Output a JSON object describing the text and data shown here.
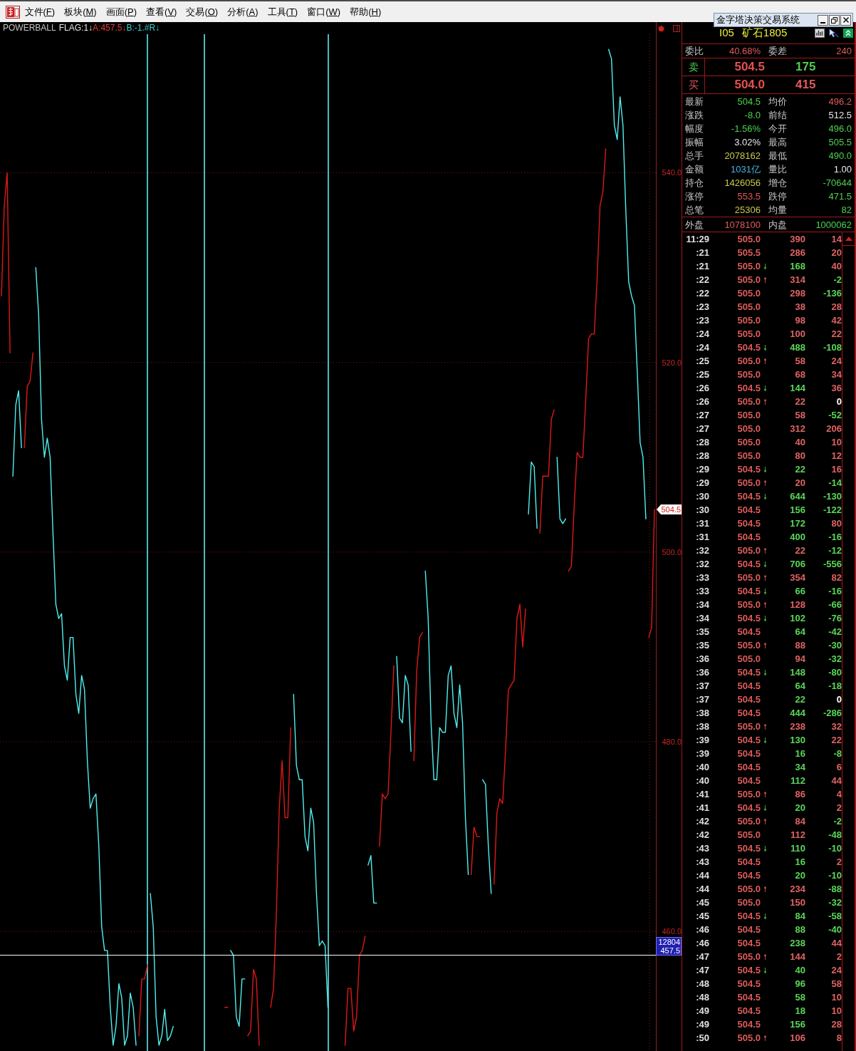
{
  "menu_bar": {
    "items": [
      {
        "before": "文件(",
        "key": "F",
        "after": ")"
      },
      {
        "before": "板块(",
        "key": "M",
        "after": ")"
      },
      {
        "before": "画面(",
        "key": "P",
        "after": ")"
      },
      {
        "before": "查看(",
        "key": "V",
        "after": ")"
      },
      {
        "before": "交易(",
        "key": "O",
        "after": ")"
      },
      {
        "before": "分析(",
        "key": "A",
        "after": ")"
      },
      {
        "before": "工具(",
        "key": "T",
        "after": ")"
      },
      {
        "before": "窗口(",
        "key": "W",
        "after": ")"
      },
      {
        "before": "帮助(",
        "key": "H",
        "after": ")"
      }
    ]
  },
  "floating_window": {
    "title": "金字塔决策交易系统"
  },
  "chart": {
    "legend": [
      {
        "text": "FLAG:1↓",
        "color": "#e4e4e4"
      },
      {
        "text": "A:457.5↓",
        "color": "#e03c3c"
      },
      {
        "text": "B:-1.#R↓",
        "color": "#3cd0d0"
      }
    ],
    "crosshair_label": "12804",
    "chart_data": {
      "type": "line",
      "title": "POWERBALL",
      "grid": true,
      "ylim": [
        447.4,
        554.6
      ],
      "yticks": [
        {
          "value": 540,
          "label": "540.0"
        },
        {
          "value": 520,
          "label": "520.0"
        },
        {
          "value": 500,
          "label": "500.0"
        },
        {
          "value": 480,
          "label": "480.0"
        },
        {
          "value": 460,
          "label": "460.0"
        }
      ],
      "series": [
        {
          "color": "#e01818",
          "values": [
            527,
            536.5,
            540,
            521,
            null,
            null,
            null,
            null,
            511,
            517.5,
            518,
            521,
            null,
            null,
            null,
            null,
            null,
            null,
            null,
            null,
            null,
            null,
            null,
            null,
            null,
            null,
            null,
            null,
            null,
            null,
            null,
            null,
            null,
            null,
            null,
            null,
            null,
            null,
            null,
            null,
            null,
            null,
            null,
            null,
            null,
            null,
            null,
            null,
            449,
            455,
            455,
            456.5,
            null,
            null,
            null,
            null,
            null,
            null,
            null,
            null,
            null,
            null,
            null,
            null,
            null,
            null,
            null,
            null,
            null,
            null,
            null,
            null,
            null,
            null,
            null,
            null,
            null,
            null,
            452,
            452,
            null,
            null,
            null,
            null,
            null,
            null,
            449,
            449.5,
            456,
            455,
            448,
            null,
            null,
            null,
            452,
            454,
            462,
            473,
            478,
            472,
            472,
            481.5,
            null,
            null,
            null,
            null,
            null,
            null,
            null,
            null,
            null,
            null,
            null,
            null,
            null,
            null,
            null,
            null,
            null,
            null,
            448,
            454,
            454,
            449.5,
            451,
            457.5,
            458,
            459.5,
            null,
            null,
            null,
            null,
            469,
            474.5,
            474,
            474.5,
            481,
            488,
            null,
            null,
            null,
            null,
            null,
            null,
            478,
            487.5,
            491,
            491.5,
            null,
            null,
            null,
            null,
            null,
            null,
            null,
            null,
            null,
            null,
            null,
            null,
            null,
            null,
            null,
            null,
            466,
            471,
            470,
            470,
            null,
            null,
            null,
            null,
            465,
            472.5,
            474,
            473.5,
            479,
            485.5,
            486,
            486.5,
            493,
            494.5,
            490,
            494,
            null,
            null,
            null,
            null,
            502,
            508,
            508,
            508,
            514,
            515,
            null,
            null,
            null,
            null,
            498,
            498.5,
            505,
            510.5,
            510,
            510,
            516,
            522.5,
            523,
            523,
            529,
            536.5,
            538,
            542.5,
            null,
            null,
            null,
            null,
            null,
            null,
            null,
            null,
            null,
            null,
            null,
            null,
            null,
            null,
            491,
            492,
            504.5
          ]
        },
        {
          "color": "#50f0f0",
          "values": [
            null,
            null,
            null,
            null,
            508,
            515.5,
            517,
            511,
            null,
            null,
            null,
            null,
            530,
            525,
            514,
            510,
            512,
            510,
            502,
            494.5,
            493,
            493.5,
            488,
            486.5,
            491,
            491,
            485,
            483,
            487,
            485.5,
            478,
            473,
            474,
            474.5,
            469,
            460.5,
            458,
            458,
            452,
            448,
            450,
            454.5,
            453,
            448,
            449,
            453.5,
            452,
            448,
            null,
            null,
            null,
            null,
            464,
            460.5,
            451,
            448,
            449,
            451.8,
            448.5,
            449,
            450,
            null,
            null,
            null,
            null,
            null,
            null,
            null,
            null,
            null,
            null,
            null,
            null,
            null,
            null,
            null,
            null,
            null,
            null,
            null,
            458,
            457.5,
            451,
            450,
            455,
            455,
            null,
            null,
            null,
            null,
            null,
            null,
            null,
            null,
            null,
            null,
            null,
            null,
            null,
            null,
            null,
            null,
            485,
            477.5,
            476,
            476,
            470,
            468.5,
            473,
            471.5,
            464,
            458.5,
            459,
            458.5,
            452,
            null,
            null,
            null,
            null,
            null,
            null,
            null,
            null,
            null,
            null,
            null,
            null,
            null,
            467,
            468,
            463,
            463,
            null,
            null,
            null,
            null,
            null,
            null,
            489,
            482.5,
            482,
            487,
            486,
            479,
            null,
            null,
            null,
            null,
            498,
            493,
            482,
            476,
            476,
            481.5,
            481,
            481,
            487,
            488,
            483,
            481.5,
            486,
            482,
            472,
            466,
            null,
            null,
            null,
            null,
            476,
            475.5,
            469,
            464,
            null,
            null,
            null,
            null,
            null,
            null,
            null,
            null,
            null,
            null,
            null,
            null,
            504,
            509.5,
            509,
            502.5,
            null,
            null,
            null,
            null,
            null,
            null,
            510,
            503.5,
            503,
            503.5,
            null,
            null,
            null,
            null,
            null,
            null,
            null,
            null,
            null,
            null,
            null,
            null,
            null,
            null,
            553,
            552,
            545,
            543.5,
            548,
            545,
            536,
            528.5,
            527,
            526,
            519,
            511.5,
            510,
            503.5,
            null,
            null,
            null
          ]
        }
      ],
      "ref_lines": [
        {
          "axis": "y",
          "value": 457.5,
          "label": "457.5"
        }
      ],
      "annotations": [
        "504.5"
      ]
    }
  },
  "quote_panel": {
    "code": "I05",
    "name": "矿石1805",
    "ratio": [
      {
        "label": "委比",
        "value": "40.68%",
        "color": "#e05a5a"
      },
      {
        "label": "委差",
        "value": "240",
        "color": "#e05a5a"
      }
    ],
    "book": [
      {
        "label": "卖",
        "price": "504.5",
        "volume": "175",
        "color": "#4ed04e"
      },
      {
        "label": "买",
        "price": "504.0",
        "volume": "415",
        "color": "#e05a5a"
      }
    ],
    "stats": [
      [
        {
          "label": "最新",
          "value": "504.5",
          "color": "#4ed04e"
        },
        {
          "label": "均价",
          "value": "496.2",
          "color": "#e05a5a"
        }
      ],
      [
        {
          "label": "涨跌",
          "value": "-8.0",
          "color": "#4ed04e"
        },
        {
          "label": "前结",
          "value": "512.5",
          "color": "#e8e8e8"
        }
      ],
      [
        {
          "label": "幅度",
          "value": "-1.56%",
          "color": "#4ed04e"
        },
        {
          "label": "今开",
          "value": "496.0",
          "color": "#4ed04e"
        }
      ],
      [
        {
          "label": "振幅",
          "value": "3.02%",
          "color": "#e8e8e8"
        },
        {
          "label": "最高",
          "value": "505.5",
          "color": "#4ed04e"
        }
      ],
      [
        {
          "label": "总手",
          "value": "2078162",
          "color": "#c8c84e"
        },
        {
          "label": "最低",
          "value": "490.0",
          "color": "#4ed04e"
        }
      ],
      [
        {
          "label": "金额",
          "value": "1031亿",
          "color": "#48b4dc"
        },
        {
          "label": "量比",
          "value": "1.00",
          "color": "#e8e8e8"
        }
      ],
      [
        {
          "label": "持仓",
          "value": "1426056",
          "color": "#c8c84e"
        },
        {
          "label": "增仓",
          "value": "-70644",
          "color": "#4ed04e"
        }
      ],
      [
        {
          "label": "涨停",
          "value": "553.5",
          "color": "#e05a5a"
        },
        {
          "label": "跌停",
          "value": "471.5",
          "color": "#4ed04e"
        }
      ],
      [
        {
          "label": "总笔",
          "value": "25306",
          "color": "#c8c84e"
        },
        {
          "label": "均量",
          "value": "82",
          "color": "#4ed04e"
        }
      ]
    ],
    "volume_split": [
      {
        "label": "外盘",
        "value": "1078100",
        "color": "#e05a5a"
      },
      {
        "label": "内盘",
        "value": "1000062",
        "color": "#4ed04e"
      }
    ],
    "ticks": [
      {
        "time": "11:29",
        "price": "505.0",
        "volume": {
          "text": "390",
          "color": "#e06464"
        },
        "change": {
          "text": "14",
          "color": "#e06464"
        }
      },
      {
        "time": ":21",
        "price": "505.5",
        "volume": {
          "text": "286",
          "color": "#e06464"
        },
        "change": {
          "text": "20",
          "color": "#e06464"
        }
      },
      {
        "time": ":21",
        "price": "505.0",
        "arrow": {
          "kind": "down",
          "color": "#3ca03c"
        },
        "volume": {
          "text": "168",
          "color": "#5ad75a"
        },
        "change": {
          "text": "40",
          "color": "#e06464"
        }
      },
      {
        "time": ":22",
        "price": "505.0",
        "arrow": {
          "kind": "up",
          "color": "#b04848"
        },
        "volume": {
          "text": "314",
          "color": "#e06464"
        },
        "change": {
          "text": "-2",
          "color": "#5ad75a"
        }
      },
      {
        "time": ":22",
        "price": "505.0",
        "volume": {
          "text": "298",
          "color": "#e06464"
        },
        "change": {
          "text": "-136",
          "color": "#5ad75a"
        }
      },
      {
        "time": ":23",
        "price": "505.0",
        "volume": {
          "text": "38",
          "color": "#e06464"
        },
        "change": {
          "text": "28",
          "color": "#e06464"
        }
      },
      {
        "time": ":23",
        "price": "505.0",
        "volume": {
          "text": "98",
          "color": "#e06464"
        },
        "change": {
          "text": "42",
          "color": "#e06464"
        }
      },
      {
        "time": ":24",
        "price": "505.0",
        "volume": {
          "text": "100",
          "color": "#e06464"
        },
        "change": {
          "text": "22",
          "color": "#e06464"
        }
      },
      {
        "time": ":24",
        "price": "504.5",
        "arrow": {
          "kind": "down",
          "color": "#3ca03c"
        },
        "volume": {
          "text": "488",
          "color": "#5ad75a"
        },
        "change": {
          "text": "-108",
          "color": "#5ad75a"
        }
      },
      {
        "time": ":25",
        "price": "505.0",
        "arrow": {
          "kind": "up",
          "color": "#b04848"
        },
        "volume": {
          "text": "58",
          "color": "#e06464"
        },
        "change": {
          "text": "24",
          "color": "#e06464"
        }
      },
      {
        "time": ":25",
        "price": "505.0",
        "volume": {
          "text": "68",
          "color": "#e06464"
        },
        "change": {
          "text": "34",
          "color": "#e06464"
        }
      },
      {
        "time": ":26",
        "price": "504.5",
        "arrow": {
          "kind": "down",
          "color": "#3ca03c"
        },
        "volume": {
          "text": "144",
          "color": "#5ad75a"
        },
        "change": {
          "text": "36",
          "color": "#e06464"
        }
      },
      {
        "time": ":26",
        "price": "505.0",
        "arrow": {
          "kind": "up",
          "color": "#b04848"
        },
        "volume": {
          "text": "22",
          "color": "#e06464"
        },
        "change": {
          "text": "0",
          "color": "#ffffff"
        }
      },
      {
        "time": ":27",
        "price": "505.0",
        "volume": {
          "text": "58",
          "color": "#e06464"
        },
        "change": {
          "text": "-52",
          "color": "#5ad75a"
        }
      },
      {
        "time": ":27",
        "price": "505.0",
        "volume": {
          "text": "312",
          "color": "#e06464"
        },
        "change": {
          "text": "206",
          "color": "#e06464"
        }
      },
      {
        "time": ":28",
        "price": "505.0",
        "volume": {
          "text": "40",
          "color": "#e06464"
        },
        "change": {
          "text": "10",
          "color": "#e06464"
        }
      },
      {
        "time": ":28",
        "price": "505.0",
        "volume": {
          "text": "80",
          "color": "#e06464"
        },
        "change": {
          "text": "12",
          "color": "#e06464"
        }
      },
      {
        "time": ":29",
        "price": "504.5",
        "arrow": {
          "kind": "down",
          "color": "#3ca03c"
        },
        "volume": {
          "text": "22",
          "color": "#5ad75a"
        },
        "change": {
          "text": "16",
          "color": "#e06464"
        }
      },
      {
        "time": ":29",
        "price": "505.0",
        "arrow": {
          "kind": "up",
          "color": "#b04848"
        },
        "volume": {
          "text": "20",
          "color": "#e06464"
        },
        "change": {
          "text": "-14",
          "color": "#5ad75a"
        }
      },
      {
        "time": ":30",
        "price": "504.5",
        "arrow": {
          "kind": "down",
          "color": "#3ca03c"
        },
        "volume": {
          "text": "644",
          "color": "#5ad75a"
        },
        "change": {
          "text": "-130",
          "color": "#5ad75a"
        }
      },
      {
        "time": ":30",
        "price": "504.5",
        "volume": {
          "text": "156",
          "color": "#5ad75a"
        },
        "change": {
          "text": "-122",
          "color": "#5ad75a"
        }
      },
      {
        "time": ":31",
        "price": "504.5",
        "volume": {
          "text": "172",
          "color": "#5ad75a"
        },
        "change": {
          "text": "80",
          "color": "#e06464"
        }
      },
      {
        "time": ":31",
        "price": "504.5",
        "volume": {
          "text": "400",
          "color": "#5ad75a"
        },
        "change": {
          "text": "-16",
          "color": "#5ad75a"
        }
      },
      {
        "time": ":32",
        "price": "505.0",
        "arrow": {
          "kind": "up",
          "color": "#b04848"
        },
        "volume": {
          "text": "22",
          "color": "#e06464"
        },
        "change": {
          "text": "-12",
          "color": "#5ad75a"
        }
      },
      {
        "time": ":32",
        "price": "504.5",
        "arrow": {
          "kind": "down",
          "color": "#3ca03c"
        },
        "volume": {
          "text": "706",
          "color": "#5ad75a"
        },
        "change": {
          "text": "-556",
          "color": "#5ad75a"
        }
      },
      {
        "time": ":33",
        "price": "505.0",
        "arrow": {
          "kind": "up",
          "color": "#b04848"
        },
        "volume": {
          "text": "354",
          "color": "#e06464"
        },
        "change": {
          "text": "82",
          "color": "#e06464"
        }
      },
      {
        "time": ":33",
        "price": "504.5",
        "arrow": {
          "kind": "down",
          "color": "#3ca03c"
        },
        "volume": {
          "text": "66",
          "color": "#5ad75a"
        },
        "change": {
          "text": "-16",
          "color": "#5ad75a"
        }
      },
      {
        "time": ":34",
        "price": "505.0",
        "arrow": {
          "kind": "up",
          "color": "#b04848"
        },
        "volume": {
          "text": "128",
          "color": "#e06464"
        },
        "change": {
          "text": "-66",
          "color": "#5ad75a"
        }
      },
      {
        "time": ":34",
        "price": "504.5",
        "arrow": {
          "kind": "down",
          "color": "#3ca03c"
        },
        "volume": {
          "text": "102",
          "color": "#5ad75a"
        },
        "change": {
          "text": "-76",
          "color": "#5ad75a"
        }
      },
      {
        "time": ":35",
        "price": "504.5",
        "volume": {
          "text": "64",
          "color": "#5ad75a"
        },
        "change": {
          "text": "-42",
          "color": "#5ad75a"
        }
      },
      {
        "time": ":35",
        "price": "505.0",
        "arrow": {
          "kind": "up",
          "color": "#b04848"
        },
        "volume": {
          "text": "88",
          "color": "#e06464"
        },
        "change": {
          "text": "-30",
          "color": "#5ad75a"
        }
      },
      {
        "time": ":36",
        "price": "505.0",
        "volume": {
          "text": "94",
          "color": "#e06464"
        },
        "change": {
          "text": "-32",
          "color": "#5ad75a"
        }
      },
      {
        "time": ":36",
        "price": "504.5",
        "arrow": {
          "kind": "down",
          "color": "#3ca03c"
        },
        "volume": {
          "text": "148",
          "color": "#5ad75a"
        },
        "change": {
          "text": "-80",
          "color": "#5ad75a"
        }
      },
      {
        "time": ":37",
        "price": "504.5",
        "volume": {
          "text": "64",
          "color": "#5ad75a"
        },
        "change": {
          "text": "-18",
          "color": "#5ad75a"
        }
      },
      {
        "time": ":37",
        "price": "504.5",
        "volume": {
          "text": "22",
          "color": "#5ad75a"
        },
        "change": {
          "text": "0",
          "color": "#ffffff"
        }
      },
      {
        "time": ":38",
        "price": "504.5",
        "volume": {
          "text": "444",
          "color": "#5ad75a"
        },
        "change": {
          "text": "-286",
          "color": "#5ad75a"
        }
      },
      {
        "time": ":38",
        "price": "505.0",
        "arrow": {
          "kind": "up",
          "color": "#b04848"
        },
        "volume": {
          "text": "238",
          "color": "#e06464"
        },
        "change": {
          "text": "32",
          "color": "#e06464"
        }
      },
      {
        "time": ":39",
        "price": "504.5",
        "arrow": {
          "kind": "down",
          "color": "#3ca03c"
        },
        "volume": {
          "text": "130",
          "color": "#5ad75a"
        },
        "change": {
          "text": "22",
          "color": "#e06464"
        }
      },
      {
        "time": ":39",
        "price": "504.5",
        "volume": {
          "text": "16",
          "color": "#5ad75a"
        },
        "change": {
          "text": "-8",
          "color": "#5ad75a"
        }
      },
      {
        "time": ":40",
        "price": "504.5",
        "volume": {
          "text": "34",
          "color": "#5ad75a"
        },
        "change": {
          "text": "6",
          "color": "#e06464"
        }
      },
      {
        "time": ":40",
        "price": "504.5",
        "volume": {
          "text": "112",
          "color": "#5ad75a"
        },
        "change": {
          "text": "44",
          "color": "#e06464"
        }
      },
      {
        "time": ":41",
        "price": "505.0",
        "arrow": {
          "kind": "up",
          "color": "#b04848"
        },
        "volume": {
          "text": "86",
          "color": "#e06464"
        },
        "change": {
          "text": "4",
          "color": "#e06464"
        }
      },
      {
        "time": ":41",
        "price": "504.5",
        "arrow": {
          "kind": "down",
          "color": "#3ca03c"
        },
        "volume": {
          "text": "20",
          "color": "#5ad75a"
        },
        "change": {
          "text": "2",
          "color": "#e06464"
        }
      },
      {
        "time": ":42",
        "price": "505.0",
        "arrow": {
          "kind": "up",
          "color": "#b04848"
        },
        "volume": {
          "text": "84",
          "color": "#e06464"
        },
        "change": {
          "text": "-2",
          "color": "#5ad75a"
        }
      },
      {
        "time": ":42",
        "price": "505.0",
        "volume": {
          "text": "112",
          "color": "#e06464"
        },
        "change": {
          "text": "-48",
          "color": "#5ad75a"
        }
      },
      {
        "time": ":43",
        "price": "504.5",
        "arrow": {
          "kind": "down",
          "color": "#3ca03c"
        },
        "volume": {
          "text": "110",
          "color": "#5ad75a"
        },
        "change": {
          "text": "-10",
          "color": "#5ad75a"
        }
      },
      {
        "time": ":43",
        "price": "504.5",
        "volume": {
          "text": "16",
          "color": "#5ad75a"
        },
        "change": {
          "text": "2",
          "color": "#e06464"
        }
      },
      {
        "time": ":44",
        "price": "504.5",
        "volume": {
          "text": "20",
          "color": "#5ad75a"
        },
        "change": {
          "text": "-10",
          "color": "#5ad75a"
        }
      },
      {
        "time": ":44",
        "price": "505.0",
        "arrow": {
          "kind": "up",
          "color": "#b04848"
        },
        "volume": {
          "text": "234",
          "color": "#e06464"
        },
        "change": {
          "text": "-88",
          "color": "#5ad75a"
        }
      },
      {
        "time": ":45",
        "price": "505.0",
        "volume": {
          "text": "150",
          "color": "#e06464"
        },
        "change": {
          "text": "-32",
          "color": "#5ad75a"
        }
      },
      {
        "time": ":45",
        "price": "504.5",
        "arrow": {
          "kind": "down",
          "color": "#3ca03c"
        },
        "volume": {
          "text": "84",
          "color": "#5ad75a"
        },
        "change": {
          "text": "-58",
          "color": "#5ad75a"
        }
      },
      {
        "time": ":46",
        "price": "504.5",
        "volume": {
          "text": "88",
          "color": "#5ad75a"
        },
        "change": {
          "text": "-40",
          "color": "#5ad75a"
        }
      },
      {
        "time": ":46",
        "price": "504.5",
        "volume": {
          "text": "238",
          "color": "#5ad75a"
        },
        "change": {
          "text": "44",
          "color": "#e06464"
        }
      },
      {
        "time": ":47",
        "price": "505.0",
        "arrow": {
          "kind": "up",
          "color": "#b04848"
        },
        "volume": {
          "text": "144",
          "color": "#e06464"
        },
        "change": {
          "text": "2",
          "color": "#e06464"
        }
      },
      {
        "time": ":47",
        "price": "504.5",
        "arrow": {
          "kind": "down",
          "color": "#3ca03c"
        },
        "volume": {
          "text": "40",
          "color": "#5ad75a"
        },
        "change": {
          "text": "24",
          "color": "#e06464"
        }
      },
      {
        "time": ":48",
        "price": "504.5",
        "volume": {
          "text": "96",
          "color": "#5ad75a"
        },
        "change": {
          "text": "58",
          "color": "#e06464"
        }
      },
      {
        "time": ":48",
        "price": "504.5",
        "volume": {
          "text": "58",
          "color": "#5ad75a"
        },
        "change": {
          "text": "10",
          "color": "#e06464"
        }
      },
      {
        "time": ":49",
        "price": "504.5",
        "volume": {
          "text": "18",
          "color": "#5ad75a"
        },
        "change": {
          "text": "10",
          "color": "#e06464"
        }
      },
      {
        "time": ":49",
        "price": "504.5",
        "volume": {
          "text": "156",
          "color": "#5ad75a"
        },
        "change": {
          "text": "28",
          "color": "#e06464"
        }
      },
      {
        "time": ":50",
        "price": "505.0",
        "arrow": {
          "kind": "up",
          "color": "#b04848"
        },
        "volume": {
          "text": "106",
          "color": "#e06464"
        },
        "change": {
          "text": "8",
          "color": "#e06464"
        }
      }
    ]
  }
}
